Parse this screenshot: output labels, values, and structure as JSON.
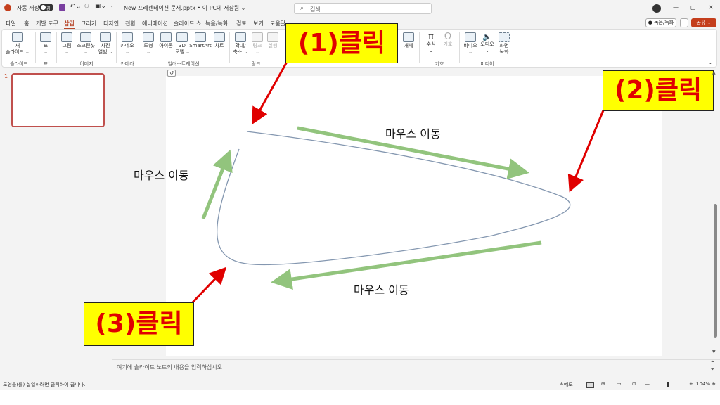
{
  "titlebar": {
    "autosave_label": "자동 저장",
    "autosave_state": "끔",
    "document_title": "New 프레젠테이션 문서.pptx • 이 PC에 저장됨 ⌄",
    "search_placeholder": "검색",
    "window_controls": [
      "—",
      "▢",
      "✕"
    ]
  },
  "tabs": [
    "파일",
    "홈",
    "개발 도구",
    "삽입",
    "그리기",
    "디자인",
    "전환",
    "애니메이션",
    "슬라이드 쇼",
    "녹음/녹화",
    "검토",
    "보기",
    "도움말"
  ],
  "active_tab": "삽입",
  "actions": {
    "record": "● 녹음/녹화",
    "share": "공유 ⌄"
  },
  "ribbon": {
    "buttons": {
      "new_slide": "새\n슬라이드 ⌄",
      "table": "표\n⌄",
      "picture": "그림\n⌄",
      "screenshot": "스크린샷\n⌄",
      "album": "사진\n앨범 ⌄",
      "camera": "카메오\n⌄",
      "shapes": "도형\n⌄",
      "icons": "아이콘",
      "models3d": "3D\n모델 ⌄",
      "smartart": "SmartArt",
      "chart": "차트",
      "zoom": "확대/\n축소 ⌄",
      "link": "링크\n⌄",
      "action": "실행",
      "object": "개체",
      "equation": "수식\n⌄",
      "symbol": "기호",
      "video": "비디오\n⌄",
      "audio": "오디오\n⌄",
      "screen_rec": "화면\n녹화"
    },
    "groups": {
      "slides": "슬라이드",
      "table": "표",
      "images": "이미지",
      "camera": "카메라",
      "illustrations": "일러스트레이션",
      "links": "링크",
      "symbols": "기호",
      "media": "미디어"
    }
  },
  "slide_panel": {
    "slide_number": "1"
  },
  "annotations": {
    "step1": "(1)클릭",
    "step2": "(2)클릭",
    "step3": "(3)클릭",
    "move_top": "마우스 이동",
    "move_left": "마우스 이동",
    "move_bottom": "마우스 이동"
  },
  "colors": {
    "accent": "#b7472a",
    "callout_bg": "#ffff00",
    "callout_text": "#e00000",
    "arrow_red": "#e00000",
    "arrow_green": "#92c47d",
    "curve": "#8497b0"
  },
  "notes_placeholder": "여기에 슬라이드 노트의 내용을 입력하십시오",
  "statusbar": {
    "hint": "도형을(를) 삽입하려면 클릭하여 끕니다.",
    "notes": "≜메모",
    "zoom": "104%"
  }
}
